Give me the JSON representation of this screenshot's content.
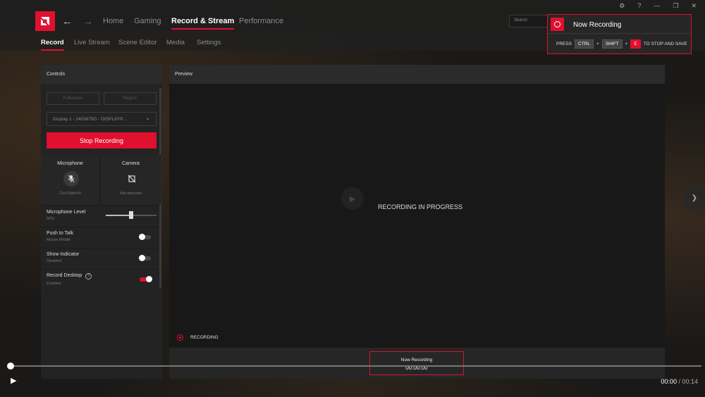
{
  "nav": {
    "back_icon": "back-arrow-icon",
    "forward_icon": "forward-arrow-icon",
    "tabs": [
      {
        "label": "Home",
        "active": false
      },
      {
        "label": "Gaming",
        "active": false
      },
      {
        "label": "Record & Stream",
        "active": true
      },
      {
        "label": "Performance",
        "active": false
      }
    ],
    "search_placeholder": "Search"
  },
  "subnav": {
    "tabs": [
      {
        "label": "Record",
        "active": true
      },
      {
        "label": "Live Stream",
        "active": false
      },
      {
        "label": "Scene Editor",
        "active": false
      },
      {
        "label": "Media",
        "active": false
      },
      {
        "label": "Settings",
        "active": false
      }
    ]
  },
  "toast": {
    "title": "Now Recording",
    "press": "PRESS",
    "key1": "CTRL",
    "plus1": "+",
    "key2": "SHIFT",
    "plus2": "+",
    "key3": "E",
    "suffix": "TO STOP AND SAVE"
  },
  "controls": {
    "title": "Controls",
    "fullscreen_label": "Fullscreen",
    "region_label": "Region",
    "stop_label": "Stop Recording",
    "display_value": "Display 1 - 24GM79G - DISPLAYP...",
    "microphone": {
      "label": "Microphone",
      "hotkey": "Ctrl+Shift+M"
    },
    "camera": {
      "label": "Camera",
      "status": "Not detected"
    },
    "mic_level": {
      "label": "Microphone Level",
      "value": "50%",
      "level": 0.5
    },
    "push_to_talk": {
      "label": "Push to Talk",
      "sub": "Mouse Middle",
      "on": false
    },
    "show_indicator": {
      "label": "Show Indicator",
      "sub": "Disabled",
      "on": false
    },
    "record_desktop": {
      "label": "Record Desktop",
      "sub": "Enabled",
      "on": true
    }
  },
  "preview": {
    "title": "Preview",
    "message": "RECORDING IN PROGRESS",
    "indicator": "RECORDING",
    "status_title": "Now Recording",
    "timer": "00:00:00"
  },
  "player": {
    "current": "00:00",
    "separator": " / ",
    "duration": "00:14",
    "progress": 0
  },
  "colors": {
    "accent": "#e0102f"
  }
}
